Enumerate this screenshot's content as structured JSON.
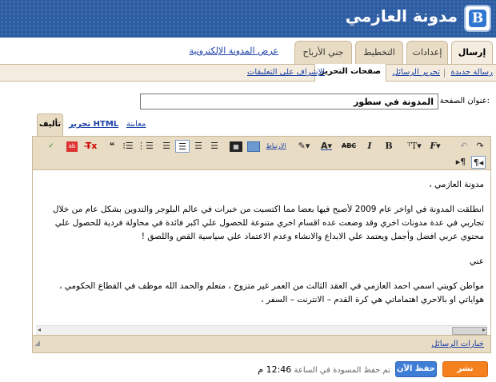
{
  "header": {
    "blog_title": "مدونة العازمي",
    "logo_letter": "B"
  },
  "tabs": {
    "publish": "إرسال",
    "settings": "إعدادات",
    "layout": "التخطيط",
    "earn": "جني الأرباح",
    "view_blog": "عرض المدونة الإلكترونية"
  },
  "subtabs": {
    "new_post": "رسالة جديدة",
    "edit_posts": "تحرير الرسائل",
    "edit_pages": "صفحات التحرير",
    "moderate_comments": "الإشراف على التعليقات"
  },
  "post_title": {
    "label": "عنوان الصفحة:",
    "value": "المدونة في سطور"
  },
  "modes": {
    "compose": "تأليف",
    "edit_html": "تحرير HTML",
    "preview": "معاينة"
  },
  "toolbar": {
    "link_label": "الارتباط"
  },
  "content": {
    "paragraphs": [
      "مدونة العازمي ،",
      "انطلقت المدونة في اواخر عام 2009 لأصبح فيها بعضا مما اكتسبت من خبرات في عالم البلوجر والتدوين بشكل عام من خلال تجاربي في عدة مدونات اخري وقد وضعت عده اقسام اخري متنوعة للحصول علي اكبر فائدة في محاولة فردية للحصول علي محتوي عربي افضل وأجمل ويعتمد علي الابداع والانشاء وعدم الاعتماد علي سياسية القص واللصق !",
      "عني",
      "مواطن كويتي اسمي احمد العازمي في العقد الثالث من العمر غير متزوج ، متعلم والحمد الله موظف في القطاع الحكومي ، هواياتي او بالاحري اهتماماتي هي كرة القدم – الانترنت – السفر ،"
    ]
  },
  "options_link": "خيارات الرسائل",
  "footer": {
    "publish_button": "نشر الصفحة",
    "save_button": "حفظ الآن",
    "status_prefix": "تم حفظ المسودة في الساعة",
    "status_time": "12:46 م"
  }
}
